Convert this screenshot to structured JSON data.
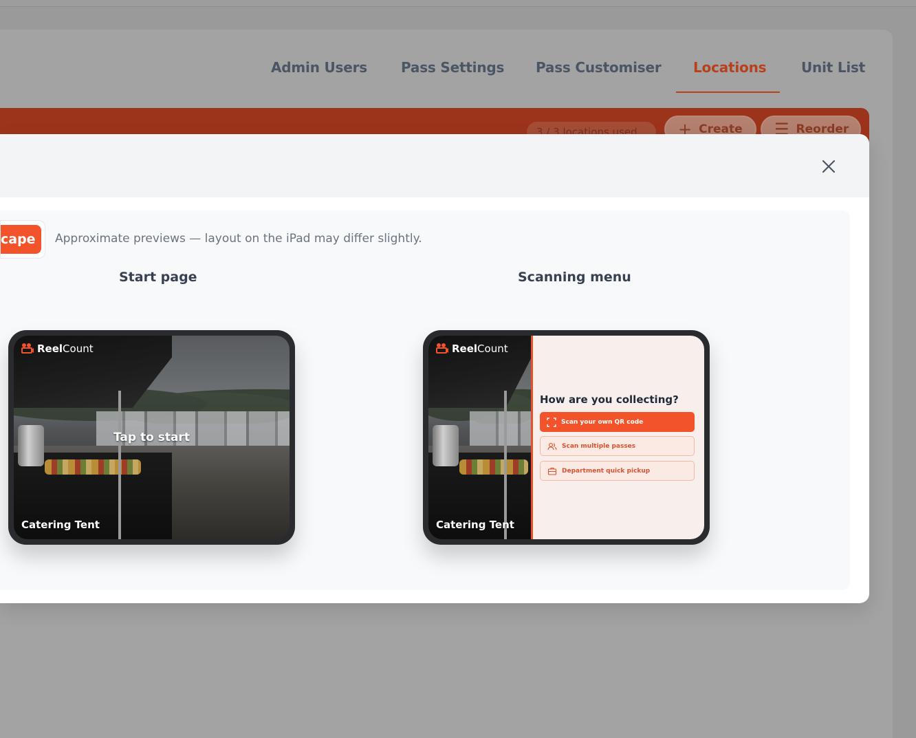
{
  "nav": {
    "tabs": [
      {
        "label": "Admin Users"
      },
      {
        "label": "Pass Settings"
      },
      {
        "label": "Pass Customiser"
      },
      {
        "label": "Locations"
      },
      {
        "label": "Unit List"
      }
    ],
    "active_tab": "Locations"
  },
  "toolbar": {
    "usage": "3 / 3 locations used",
    "create_label": "Create",
    "reorder_label": "Reorder"
  },
  "modal": {
    "orientation_label": "cape",
    "hint": "Approximate previews — layout on the iPad may differ slightly.",
    "start_page": {
      "title": "Start page",
      "brand_bold": "Reel",
      "brand_rest": "Count",
      "tap_text": "Tap to start",
      "location": "Catering Tent"
    },
    "scanning_menu": {
      "title": "Scanning menu",
      "brand_bold": "Reel",
      "brand_rest": "Count",
      "question": "How are you collecting?",
      "options": [
        {
          "label": "Scan your own QR code",
          "icon": "scan-frame-icon"
        },
        {
          "label": "Scan multiple passes",
          "icon": "users-icon"
        },
        {
          "label": "Department quick pickup",
          "icon": "briefcase-icon"
        }
      ],
      "location": "Catering Tent"
    }
  },
  "colors": {
    "accent": "#f2532a",
    "active_tab": "#b8401a",
    "menu_bg": "#f8efed"
  }
}
